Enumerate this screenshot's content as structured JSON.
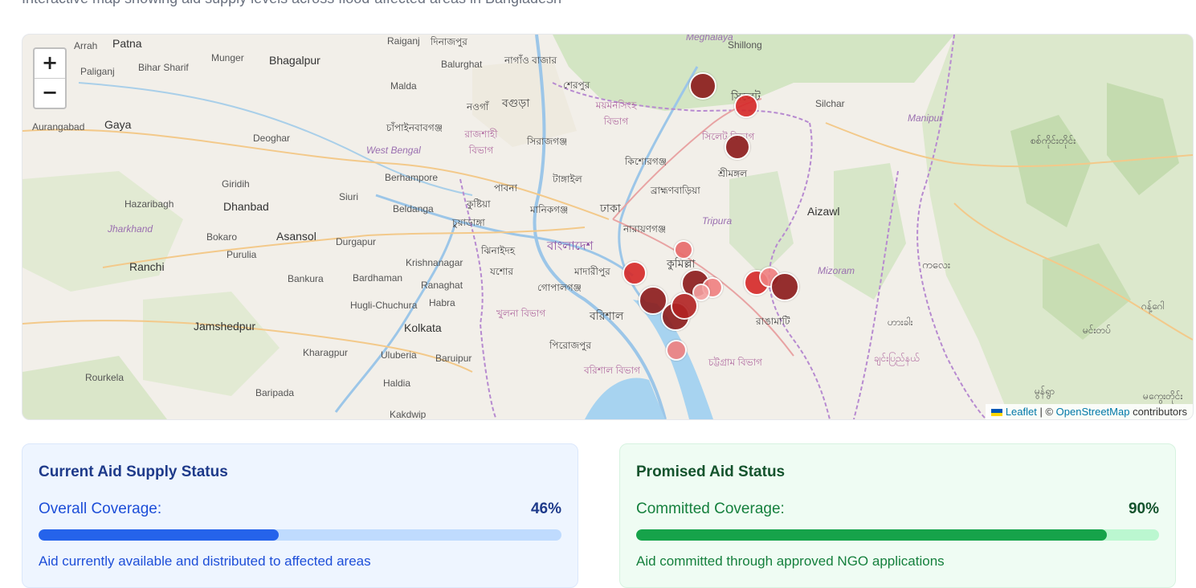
{
  "page": {
    "subtitle": "Interactive map showing aid supply levels across flood-affected areas in Bangladesh"
  },
  "map": {
    "zoom_in": "+",
    "zoom_out": "−",
    "attribution": {
      "leaflet": "Leaflet",
      "sep": " | © ",
      "osm": "OpenStreetMap",
      "suffix": " contributors"
    },
    "labels": {
      "meghalaya": "Meghalaya",
      "shillong": "Shillong",
      "raiganj": "Raiganj",
      "dinajpur": "দিনাজপুর",
      "arrah": "Arrah",
      "patna": "Patna",
      "paliganj": "Paliganj",
      "bihar_sharif": "Bihar Sharif",
      "munger": "Munger",
      "bhagalpur": "Bhagalpur",
      "balurghat": "Balurghat",
      "naogaon_bazar": "নাগাঁও বাজার",
      "malda": "Malda",
      "sherpur": "শেরপুর",
      "mymensingh": "ময়মনসিংহ বিভাগ",
      "sylhet": "সিলেট",
      "silchar": "Silchar",
      "manipur": "Manipur",
      "aurangabad": "Aurangabad",
      "gaya": "Gaya",
      "naogaon": "নওগাঁ",
      "bogura": "বগুড়া",
      "chapai": "চাঁপাইনবাবগঞ্জ",
      "rajshahi": "রাজশাহী বিভাগ",
      "west_bengal": "West Bengal",
      "deoghar": "Deoghar",
      "sirajganj": "সিরাজগঞ্জ",
      "sylhet_div": "সিলেট বিভাগ",
      "kishoreganj": "কিশোরগঞ্জ",
      "sreemangal": "শ্রীমঙ্গল",
      "giridih": "Giridih",
      "dhanbad": "Dhanbad",
      "hazaribagh": "Hazaribagh",
      "jharkhand": "Jharkhand",
      "berhampore": "Berhampore",
      "siuri": "Siuri",
      "pabna": "পাবনা",
      "tangail": "টাঙ্গাইল",
      "brahmanbaria": "ব্রাহ্মণবাড়িয়া",
      "aizawl": "Aizawl",
      "beldanga": "Beldanga",
      "kushtia": "কুষ্টিয়া",
      "chuadanga": "চুয়াডাঙ্গা",
      "manikganj": "মানিকগঞ্জ",
      "dhaka": "ঢাকা",
      "narayanganj": "নারায়ণগঞ্জ",
      "tripura": "Tripura",
      "bokaro": "Bokaro",
      "asansol": "Asansol",
      "durgapur": "Durgapur",
      "purulia": "Purulia",
      "ranchi": "Ranchi",
      "bangladesh": "বাংলাদেশ",
      "jhenaidah": "ঝিনাইদহ",
      "comilla": "কুমিল্লা",
      "mizoram": "Mizoram",
      "krishnanagar": "Krishnanagar",
      "jessore": "যশোর",
      "madaripur": "মাদারীপুর",
      "bankura": "Bankura",
      "bardhaman": "Bardhaman",
      "ranaghat": "Ranaghat",
      "gopalganj": "গোপালগঞ্জ",
      "hugli": "Hugli-Chuchura",
      "habra": "Habra",
      "khulna_div": "খুলনা বিভাগ",
      "barishal": "বরিশাল",
      "rangamati": "রাঙামাটি",
      "jamshedpur": "Jamshedpur",
      "kolkata": "Kolkata",
      "kharagpur": "Kharagpur",
      "uluberia": "Uluberia",
      "baruipur": "Baruipur",
      "pirojpur": "পিরোজপুর",
      "chattogram_div": "চট্টগ্রাম বিভাগ",
      "barishal_div": "বরিশাল বিভাগ",
      "rourkela": "Rourkela",
      "haldia": "Haldia",
      "baripada": "Baripada",
      "kakdwip": "Kakdwip",
      "my_kalay": "ကလေး",
      "my_hakha": "ဟားခါး",
      "my_matupi": "ချင်းပြည်နယ်",
      "my_sagaing": "စစ်ကိုင်းတိုင်း",
      "my_mindat": "မင်းတပ်",
      "my_gangaw": "ဂန့်ဂေါ",
      "my_mrauk": "မွန်ရွာ",
      "my_magway": "မကွေးတိုင်း"
    },
    "marker_colors": {
      "dark": "#8b1a1a",
      "mid": "#b22222",
      "bright": "#d62828",
      "light": "#f08080"
    }
  },
  "cards": {
    "current": {
      "title": "Current Aid Supply Status",
      "label": "Overall Coverage:",
      "value": "46%",
      "progress": 0.46,
      "note": "Aid currently available and distributed to affected areas"
    },
    "promised": {
      "title": "Promised Aid Status",
      "label": "Committed Coverage:",
      "value": "90%",
      "progress": 0.9,
      "note": "Aid committed through approved NGO applications"
    }
  }
}
